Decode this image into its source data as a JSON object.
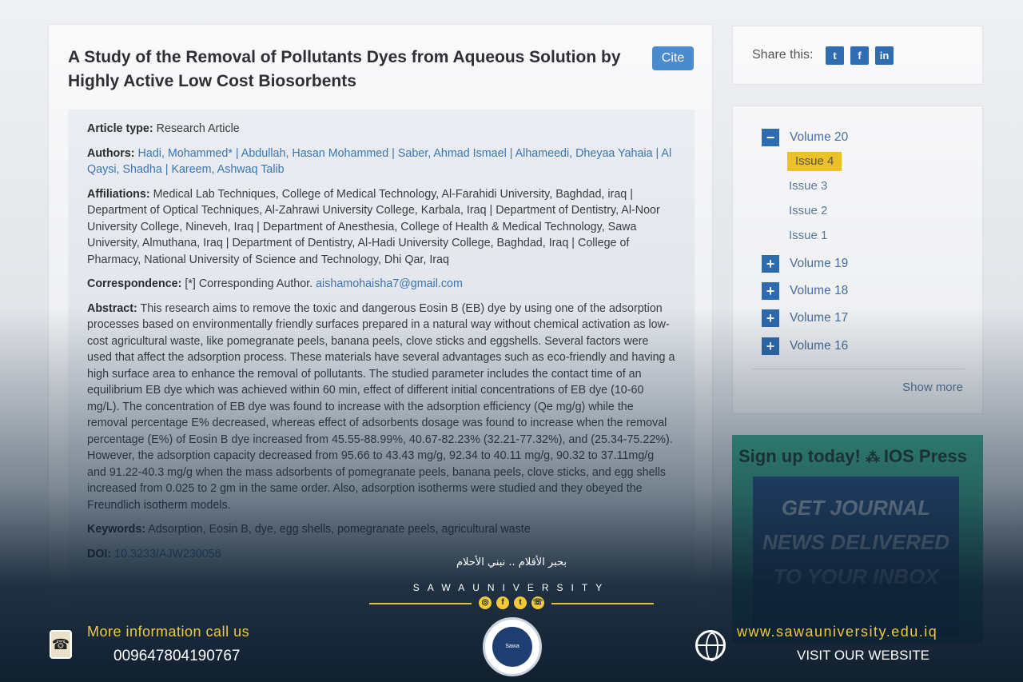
{
  "article": {
    "title": "A Study of the Removal of Pollutants Dyes from Aqueous Solution by Highly Active Low Cost Biosorbents",
    "cite_label": "Cite",
    "type_label": "Article type:",
    "type_value": "Research Article",
    "authors_label": "Authors:",
    "authors_value": "Hadi, Mohammed* | Abdullah, Hasan Mohammed | Saber, Ahmad Ismael | Alhameedi, Dheyaa Yahaia | Al Qaysi, Shadha | Kareem, Ashwaq Talib",
    "affiliations_label": "Affiliations:",
    "affiliations_value": "Medical Lab Techniques, College of Medical Technology, Al-Farahidi University, Baghdad, iraq | Department of Optical Techniques, Al-Zahrawi University College, Karbala, Iraq | Department of Dentistry, Al-Noor University College, Nineveh, Iraq | Department of Anesthesia, College of Health & Medical Technology, Sawa University, Almuthana, Iraq | Department of Dentistry, Al-Hadi University College, Baghdad, Iraq | College of Pharmacy, National University of Science and Technology, Dhi Qar, Iraq",
    "correspondence_label": "Correspondence:",
    "correspondence_value": "[*] Corresponding Author.",
    "correspondence_email": "aishamohaisha7@gmail.com",
    "abstract_label": "Abstract:",
    "abstract_value": "This research aims to remove the toxic and dangerous Eosin B (EB) dye by using one of the adsorption processes based on environmentally friendly surfaces prepared in a natural way without chemical activation as low-cost agricultural waste, like pomegranate peels, banana peels, clove sticks and eggshells. Several factors were used that affect the adsorption process. These materials have several advantages such as eco-friendly and having a high surface area to enhance the removal of pollutants. The studied parameter includes the contact time of an equilibrium EB dye which was achieved within 60 min, effect of different initial concentrations of EB dye (10-60 mg/L). The concentration of EB dye was found to increase with the adsorption efficiency (Qe mg/g) while the removal percentage E% decreased, whereas effect of adsorbents dosage was found to increase when the removal percentage (E%) of Eosin B dye increased from 45.55-88.99%, 40.67-82.23% (32.21-77.32%), and (25.34-75.22%). However, the adsorption capacity decreased from 95.66 to 43.43 mg/g, 92.34 to 40.11 mg/g, 90.32 to 37.11mg/g and 91.22-40.3 mg/g when the mass adsorbents of pomegranate peels, banana peels, clove sticks, and egg shells increased from 0.025 to 2 gm in the same order. Also, adsorption isotherms were studied and they obeyed the Freundlich isotherm models.",
    "keywords_label": "Keywords:",
    "keywords_value": "Adsorption, Eosin B, dye, egg shells, pomegranate peels, agricultural waste",
    "doi_label": "DOI:",
    "doi_value": "10.3233/AJW230056"
  },
  "share": {
    "label": "Share this:",
    "twitter": "t",
    "facebook": "f",
    "linkedin": "in"
  },
  "volumes": {
    "expanded": {
      "label": "Volume 20",
      "toggle": "−"
    },
    "issues": [
      {
        "label": "Issue 4",
        "active": true
      },
      {
        "label": "Issue 3",
        "active": false
      },
      {
        "label": "Issue 2",
        "active": false
      },
      {
        "label": "Issue 1",
        "active": false
      }
    ],
    "collapsed": [
      {
        "label": "Volume 19",
        "toggle": "+"
      },
      {
        "label": "Volume 18",
        "toggle": "+"
      },
      {
        "label": "Volume 17",
        "toggle": "+"
      },
      {
        "label": "Volume 16",
        "toggle": "+"
      }
    ],
    "show_more": "Show more"
  },
  "ad": {
    "headline": "Sign up today!",
    "brand": "IOS Press",
    "line1": "GET JOURNAL",
    "line2": "NEWS DELIVERED",
    "line3": "TO YOUR INBOX"
  },
  "footer": {
    "tagline": "بحبر الأقلام .. نبني الأحلام",
    "brand": "SAWAUNIVERSITY",
    "seal_text": "Sawa University",
    "info_label": "More information call us",
    "phone": "009647804190767",
    "url": "www.sawauniversity.edu.iq",
    "visit": "VISIT OUR WEBSITE"
  },
  "colors": {
    "accent": "#2f6db3",
    "active_issue": "#f2c42b",
    "footer_gold": "#f0c93c"
  }
}
